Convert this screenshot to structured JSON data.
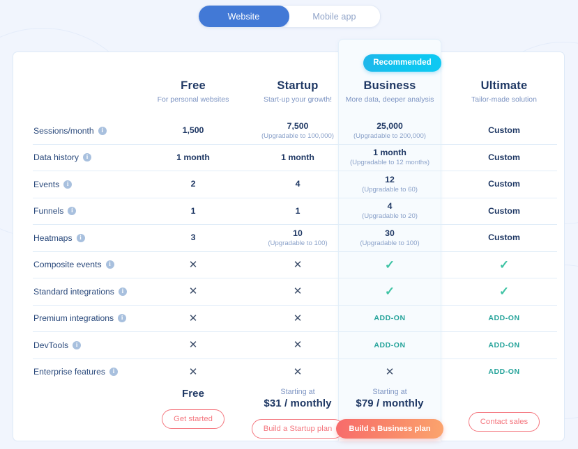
{
  "toggle": {
    "options": [
      {
        "label": "Website",
        "active": true
      },
      {
        "label": "Mobile app",
        "active": false
      }
    ]
  },
  "colors": {
    "page_background": "#f1f5fd",
    "toggle_active": "#4279d6",
    "badge_gradient_from": "#1fb6ea",
    "badge_gradient_to": "#0fc9f2",
    "plan_name": "#1f3864",
    "plan_tagline": "#7e95c3",
    "check_green": "#3ec3a4",
    "addon_teal": "#25a39a",
    "cross_dark": "#3e4f6b",
    "cta_outline": "#f4777f",
    "cta_filled_from": "#f76b6b",
    "cta_filled_to": "#fba46d",
    "highlight_column": "#f7fbfe",
    "row_divider": "#e1edf8"
  },
  "plans": [
    {
      "key": "free",
      "name": "Free",
      "tagline": "For personal websites",
      "recommended": false
    },
    {
      "key": "startup",
      "name": "Startup",
      "tagline": "Start-up your growth!",
      "recommended": false
    },
    {
      "key": "business",
      "name": "Business",
      "tagline": "More data, deeper analysis",
      "recommended": true,
      "badge": "Recommended"
    },
    {
      "key": "ultimate",
      "name": "Ultimate",
      "tagline": "Tailor-made solution",
      "recommended": false
    }
  ],
  "features": [
    {
      "label": "Sessions/month",
      "has_info": true,
      "cells": [
        {
          "type": "text",
          "main": "1,500",
          "sub": ""
        },
        {
          "type": "text",
          "main": "7,500",
          "sub": "(Upgradable to 100,000)"
        },
        {
          "type": "text",
          "main": "25,000",
          "sub": "(Upgradable to 200,000)"
        },
        {
          "type": "text",
          "main": "Custom",
          "sub": ""
        }
      ]
    },
    {
      "label": "Data history",
      "has_info": true,
      "cells": [
        {
          "type": "text",
          "main": "1 month",
          "sub": ""
        },
        {
          "type": "text",
          "main": "1 month",
          "sub": ""
        },
        {
          "type": "text",
          "main": "1 month",
          "sub": "(Upgradable to 12 months)"
        },
        {
          "type": "text",
          "main": "Custom",
          "sub": ""
        }
      ]
    },
    {
      "label": "Events",
      "has_info": true,
      "cells": [
        {
          "type": "text",
          "main": "2",
          "sub": ""
        },
        {
          "type": "text",
          "main": "4",
          "sub": ""
        },
        {
          "type": "text",
          "main": "12",
          "sub": "(Upgradable to 60)"
        },
        {
          "type": "text",
          "main": "Custom",
          "sub": ""
        }
      ]
    },
    {
      "label": "Funnels",
      "has_info": true,
      "cells": [
        {
          "type": "text",
          "main": "1",
          "sub": ""
        },
        {
          "type": "text",
          "main": "1",
          "sub": ""
        },
        {
          "type": "text",
          "main": "4",
          "sub": "(Upgradable to 20)"
        },
        {
          "type": "text",
          "main": "Custom",
          "sub": ""
        }
      ]
    },
    {
      "label": "Heatmaps",
      "has_info": true,
      "cells": [
        {
          "type": "text",
          "main": "3",
          "sub": ""
        },
        {
          "type": "text",
          "main": "10",
          "sub": "(Upgradable to 100)"
        },
        {
          "type": "text",
          "main": "30",
          "sub": "(Upgradable to 100)"
        },
        {
          "type": "text",
          "main": "Custom",
          "sub": ""
        }
      ]
    },
    {
      "label": "Composite events",
      "has_info": true,
      "cells": [
        {
          "type": "cross"
        },
        {
          "type": "cross"
        },
        {
          "type": "check"
        },
        {
          "type": "check"
        }
      ]
    },
    {
      "label": "Standard integrations",
      "has_info": true,
      "cells": [
        {
          "type": "cross"
        },
        {
          "type": "cross"
        },
        {
          "type": "check"
        },
        {
          "type": "check"
        }
      ]
    },
    {
      "label": "Premium integrations",
      "has_info": true,
      "cells": [
        {
          "type": "cross"
        },
        {
          "type": "cross"
        },
        {
          "type": "addon",
          "main": "ADD-ON"
        },
        {
          "type": "addon",
          "main": "ADD-ON"
        }
      ]
    },
    {
      "label": "DevTools",
      "has_info": true,
      "cells": [
        {
          "type": "cross"
        },
        {
          "type": "cross"
        },
        {
          "type": "addon",
          "main": "ADD-ON"
        },
        {
          "type": "addon",
          "main": "ADD-ON"
        }
      ]
    },
    {
      "label": "Enterprise features",
      "has_info": true,
      "cells": [
        {
          "type": "cross"
        },
        {
          "type": "cross"
        },
        {
          "type": "cross"
        },
        {
          "type": "addon",
          "main": "ADD-ON"
        }
      ]
    }
  ],
  "footer": [
    {
      "key": "free",
      "price_pre": "",
      "price_main": "Free",
      "cta_label": "Get started",
      "cta_style": "outline"
    },
    {
      "key": "startup",
      "price_pre": "Starting at",
      "price_main": "$31 / monthly",
      "cta_label": "Build a Startup plan",
      "cta_style": "outline"
    },
    {
      "key": "business",
      "price_pre": "Starting at",
      "price_main": "$79 / monthly",
      "cta_label": "Build a Business plan",
      "cta_style": "filled"
    },
    {
      "key": "ultimate",
      "price_pre": "",
      "price_main": "",
      "cta_label": "Contact sales",
      "cta_style": "outline"
    }
  ]
}
